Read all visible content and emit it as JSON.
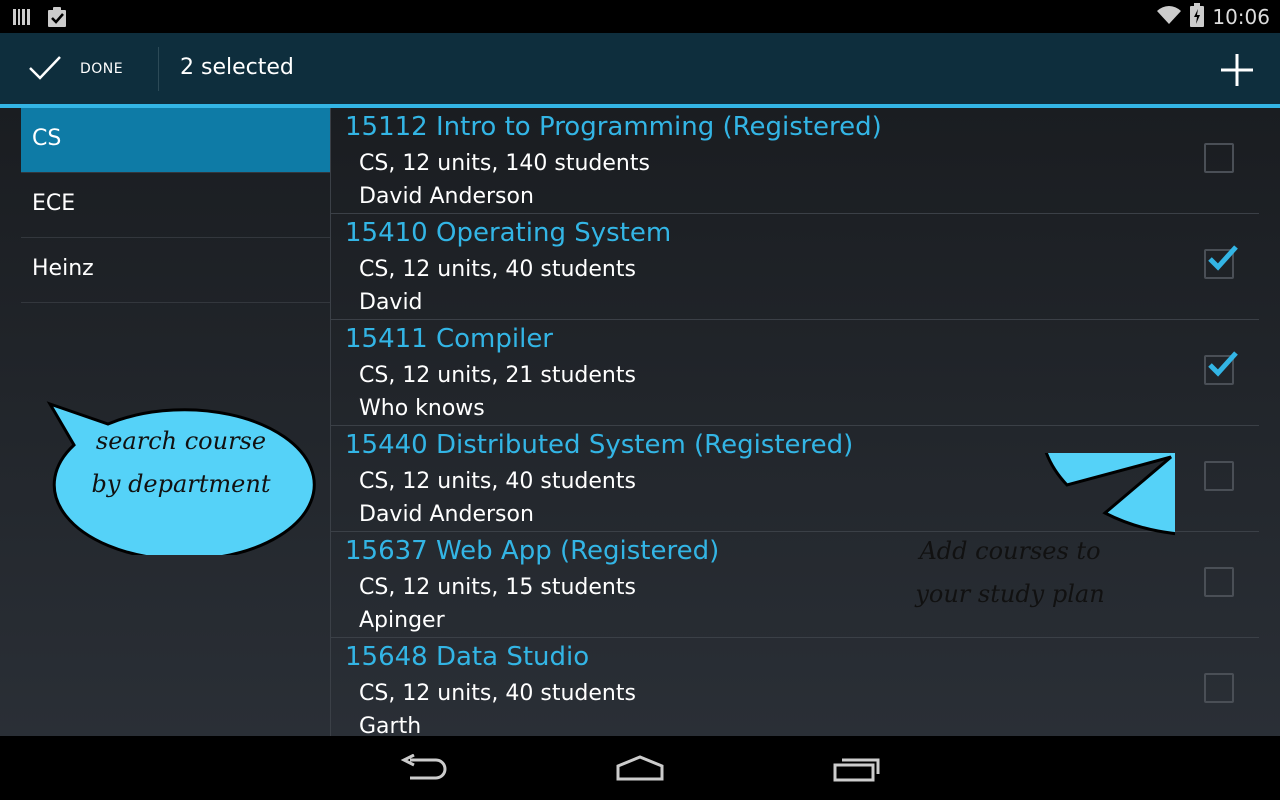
{
  "status_bar": {
    "time": "10:06",
    "icons": [
      "barcode-icon",
      "clipboard-check-icon",
      "wifi-icon",
      "battery-icon"
    ]
  },
  "action_bar": {
    "done_label": "DONE",
    "title": "2 selected",
    "icons": [
      "checkmark-icon",
      "plus-icon"
    ]
  },
  "departments": [
    {
      "label": "CS",
      "selected": true
    },
    {
      "label": "ECE",
      "selected": false
    },
    {
      "label": "Heinz",
      "selected": false
    }
  ],
  "courses": [
    {
      "title": "15112 Intro to Programming (Registered)",
      "info": "CS, 12 units, 140 students",
      "instructor": "David Anderson",
      "checked": false
    },
    {
      "title": "15410 Operating System",
      "info": "CS, 12 units, 40 students",
      "instructor": "David",
      "checked": true
    },
    {
      "title": "15411 Compiler",
      "info": "CS, 12 units, 21 students",
      "instructor": "Who knows",
      "checked": true
    },
    {
      "title": "15440 Distributed System (Registered)",
      "info": "CS, 12 units, 40 students",
      "instructor": "David Anderson",
      "checked": false
    },
    {
      "title": "15637 Web App (Registered)",
      "info": "CS, 12 units, 15 students",
      "instructor": "Apinger",
      "checked": false
    },
    {
      "title": "15648 Data Studio",
      "info": "CS, 12 units, 40 students",
      "instructor": "Garth",
      "checked": false
    }
  ],
  "annotations": {
    "left_bubble": [
      "search course",
      "by department"
    ],
    "right_bubble": [
      "Add courses to",
      "your study plan"
    ]
  },
  "nav_bar": {
    "icons": [
      "back-icon",
      "home-icon",
      "recent-apps-icon"
    ]
  },
  "colors": {
    "accent": "#33b5e5",
    "action_bar": "#0e2e3d",
    "selected_item": "#0e7ba6",
    "bubble": "#55d2f8"
  }
}
